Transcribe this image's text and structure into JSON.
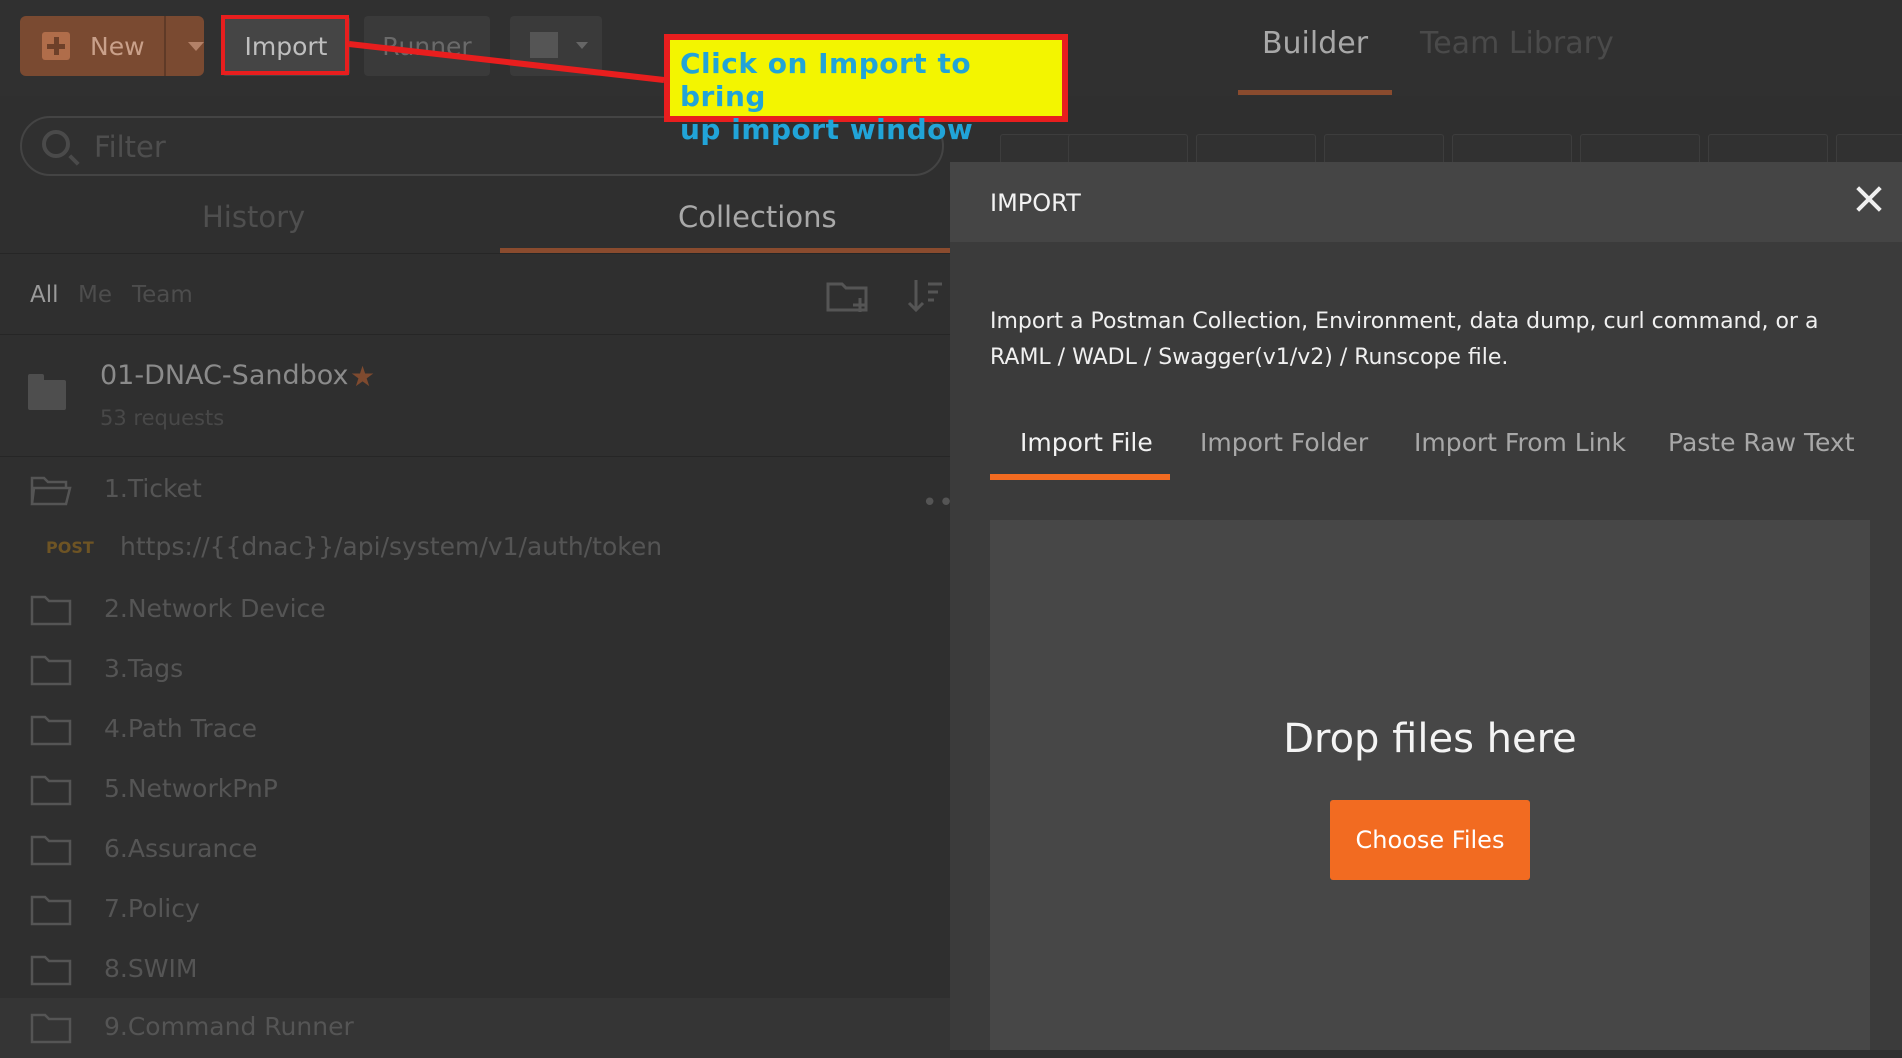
{
  "toolbar": {
    "new_label": "New",
    "import_label": "Import",
    "runner_label": "Runner",
    "tab_builder": "Builder",
    "tab_team_library": "Team Library"
  },
  "annotation": {
    "line1": "Click on Import to bring",
    "line2": "up import window",
    "highlight_color": "#e81e1e",
    "background_color": "#f3f500",
    "text_color": "#21a4d8"
  },
  "sidebar": {
    "filter_placeholder": "Filter",
    "tabs": {
      "history": "History",
      "collections": "Collections"
    },
    "filters": {
      "all": "All",
      "me": "Me",
      "team": "Team"
    },
    "collection": {
      "name": "01-DNAC-Sandbox",
      "count": "53 requests",
      "starred": true
    },
    "items": [
      {
        "label": "1.Ticket",
        "type": "folder-open"
      },
      {
        "method": "POST",
        "label": "https://{{dnac}}/api/system/v1/auth/token",
        "type": "request"
      },
      {
        "label": "2.Network Device",
        "type": "folder"
      },
      {
        "label": "3.Tags",
        "type": "folder"
      },
      {
        "label": "4.Path Trace",
        "type": "folder"
      },
      {
        "label": "5.NetworkPnP",
        "type": "folder"
      },
      {
        "label": "6.Assurance",
        "type": "folder"
      },
      {
        "label": "7.Policy",
        "type": "folder"
      },
      {
        "label": "8.SWIM",
        "type": "folder"
      },
      {
        "label": "9.Command Runner",
        "type": "folder"
      }
    ]
  },
  "modal": {
    "title": "IMPORT",
    "description": "Import a Postman Collection, Environment, data dump, curl command, or a RAML / WADL / Swagger(v1/v2) / Runscope file.",
    "tabs": [
      "Import File",
      "Import Folder",
      "Import From Link",
      "Paste Raw Text"
    ],
    "active_tab": "Import File",
    "drop_text": "Drop files here",
    "choose_button": "Choose Files",
    "accent_color": "#f26b21"
  }
}
